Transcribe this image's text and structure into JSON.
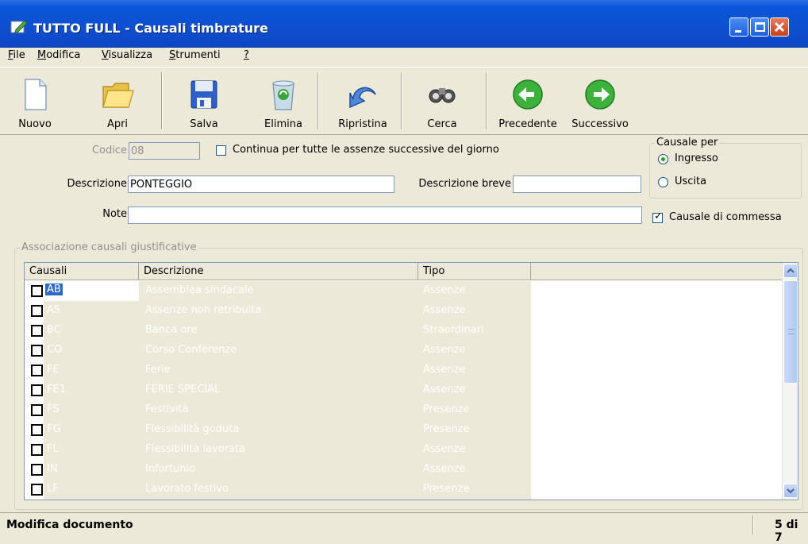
{
  "window": {
    "title": "TUTTO FULL - Causali timbrature"
  },
  "menu": [
    {
      "pre": "",
      "u": "F",
      "post": "ile"
    },
    {
      "pre": "",
      "u": "M",
      "post": "odifica"
    },
    {
      "pre": "",
      "u": "V",
      "post": "isualizza"
    },
    {
      "pre": "",
      "u": "S",
      "post": "trumenti"
    },
    {
      "pre": "",
      "u": "?",
      "post": ""
    }
  ],
  "toolbar": {
    "nuovo": "Nuovo",
    "apri": "Apri",
    "salva": "Salva",
    "elimina": "Elimina",
    "ripristina": "Ripristina",
    "cerca": "Cerca",
    "precedente": "Precedente",
    "successivo": "Successivo"
  },
  "form": {
    "codice_label": "Codice",
    "codice_value": "08",
    "continua_label": "Continua per tutte le assenze successive del giorno",
    "descrizione_label": "Descrizione",
    "descrizione_value": "PONTEGGIO",
    "desc_breve_label": "Descrizione breve",
    "desc_breve_value": "",
    "note_label": "Note",
    "note_value": "",
    "causale_per_title": "Causale per",
    "ingresso_label": "Ingresso",
    "uscita_label": "Uscita",
    "commessa_label": "Causale di commessa"
  },
  "grid": {
    "group_title": "Associazione causali giustificative",
    "headers": [
      "Causali",
      "Descrizione",
      "Tipo"
    ],
    "rows": [
      {
        "code": "AB",
        "desc": "Assemblea sindacale",
        "tipo": "Assenze"
      },
      {
        "code": "AS",
        "desc": "Assenze non retribuita",
        "tipo": "Assenze"
      },
      {
        "code": "BC",
        "desc": "Banca ore",
        "tipo": "Straordinari"
      },
      {
        "code": "CO",
        "desc": "Corso Conferenze",
        "tipo": "Assenze"
      },
      {
        "code": "FE",
        "desc": "Ferie",
        "tipo": "Assenze"
      },
      {
        "code": "FE1",
        "desc": "FERIE SPECIAL",
        "tipo": "Assenze"
      },
      {
        "code": "FS",
        "desc": "Festività",
        "tipo": "Presenze"
      },
      {
        "code": "FG",
        "desc": "Flessibilità goduta",
        "tipo": "Presenze"
      },
      {
        "code": "FL",
        "desc": "Flessibilità lavorata",
        "tipo": "Assenze"
      },
      {
        "code": "IN",
        "desc": "Infortunio",
        "tipo": "Assenze"
      },
      {
        "code": "LF",
        "desc": "Lavorato festivo",
        "tipo": "Presenze"
      }
    ]
  },
  "status": {
    "left": "Modifica documento",
    "right": "5 di 7"
  },
  "colors": {
    "titlebar": "#0a55d7",
    "face": "#ece9d8",
    "close": "#c8401c"
  }
}
